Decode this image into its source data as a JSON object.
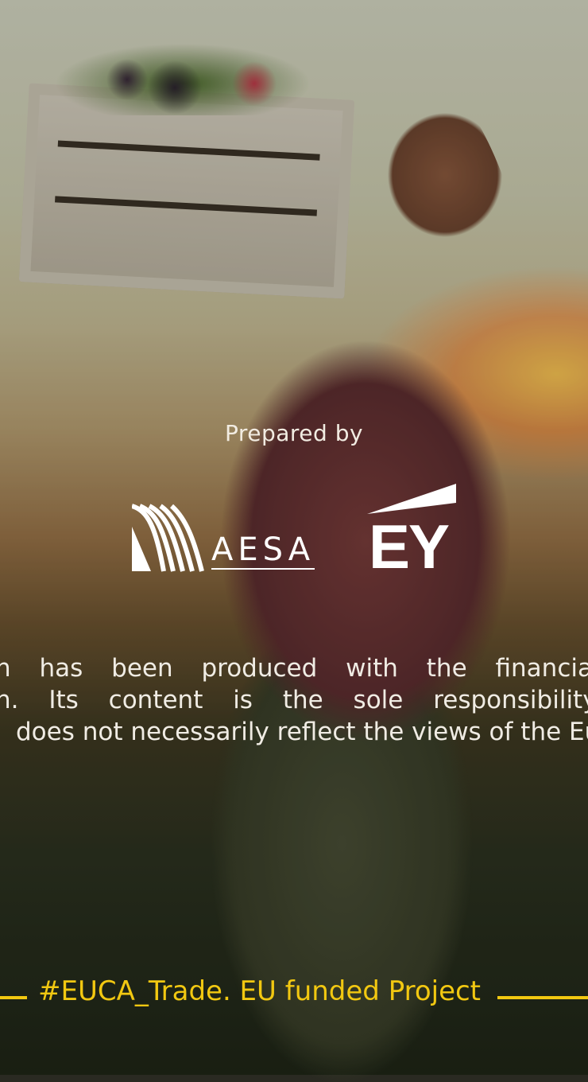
{
  "prepared_by": "Prepared by",
  "logos": {
    "aesa": "AESA",
    "ey": "EY"
  },
  "disclaimer": {
    "line1": "n has been produced with the financial supp",
    "line2": "n. Its content is the sole responsibility of th",
    "line3": "does not necessarily reflect the views of the Europ"
  },
  "footer": {
    "hashtag": "#EUCA_Trade. EU funded Project"
  },
  "colors": {
    "accent_yellow": "#f2c811",
    "text_light": "#f0ece4"
  }
}
